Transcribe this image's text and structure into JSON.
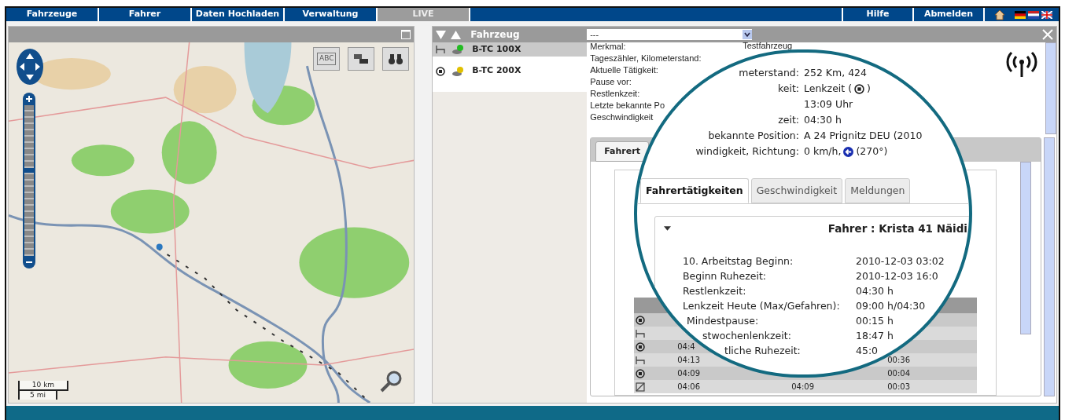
{
  "nav": {
    "tabs": [
      {
        "label": "Fahrzeuge",
        "selected": false
      },
      {
        "label": "Fahrer",
        "selected": false
      },
      {
        "label": "Daten Hochladen",
        "selected": false
      },
      {
        "label": "Verwaltung",
        "selected": false
      },
      {
        "label": "LIVE",
        "selected": true
      }
    ],
    "links": [
      "Hilfe",
      "Abmelden"
    ]
  },
  "map": {
    "toolbar": [
      {
        "kind": "labels",
        "text": "ABC"
      },
      {
        "kind": "traffic"
      },
      {
        "kind": "binoculars"
      }
    ],
    "zoom": {
      "level": 0.57
    },
    "scale": [
      "10 km",
      "5 mi"
    ]
  },
  "vehicles": {
    "header": "Fahrzeug",
    "filter": "---",
    "items": [
      {
        "name": "B-TC 100X",
        "kind": "rest",
        "selected": true,
        "color": "#22bb22"
      },
      {
        "name": "B-TC 200X",
        "kind": "driving",
        "selected": false,
        "color": "#e0c000"
      }
    ]
  },
  "details": {
    "labels": [
      "Merkmal:",
      "Tageszähler, Kilometerstand:",
      "Aktuelle Tätigkeit:",
      "Pause vor:",
      "Restlenkzeit:",
      "Letzte bekannte Po",
      "Geschwindigkeit"
    ],
    "value": "Testfahrzeug",
    "tab": "Fahrert"
  },
  "magnifier": {
    "rows": [
      {
        "kind": "plain",
        "label": "meterstand:",
        "value": "252 Km, 424"
      },
      {
        "kind": "driving",
        "label": "keit:",
        "value": "Lenkzeit (",
        "suffix": ")"
      },
      {
        "kind": "plain",
        "label": "",
        "value": "13:09 Uhr"
      },
      {
        "kind": "plain",
        "label": "zeit:",
        "value": "04:30 h"
      },
      {
        "kind": "plain",
        "label": "bekannte Position:",
        "value": "A 24 Prignitz DEU (2010"
      },
      {
        "kind": "direction",
        "label": "windigkeit, Richtung:",
        "value": "0 km/h,",
        "suffix": "(270°)"
      }
    ],
    "tabs": [
      {
        "label": "Fahrertätigkeiten",
        "selected": true
      },
      {
        "label": "Geschwindigkeit",
        "selected": false
      },
      {
        "label": "Meldungen",
        "selected": false
      }
    ],
    "card": {
      "title": "Fahrer : Krista 41 Näidi",
      "rows": [
        {
          "label": "10. Arbeitstag Beginn:",
          "value": "2010-12-03 03:02"
        },
        {
          "label": "Beginn Ruhezeit:",
          "value": "2010-12-03 16:0"
        },
        {
          "label": "Restlenkzeit:",
          "value": "04:30 h"
        },
        {
          "label": "Lenkzeit Heute (Max/Gefahren):",
          "value": "09:00 h/04:30"
        },
        {
          "label": "Mindestpause:",
          "value": "00:15 h"
        },
        {
          "label": "stwochenlenkzeit:",
          "value": "18:47 h"
        },
        {
          "label": "tliche Ruhezeit:",
          "value": "45:0"
        }
      ]
    }
  },
  "table": {
    "rows": [
      {
        "kind": "driving",
        "cells": [
          "",
          "",
          ""
        ]
      },
      {
        "kind": "rest",
        "cells": [
          "",
          "",
          ""
        ]
      },
      {
        "kind": "driving",
        "cells": [
          "04:4",
          "",
          ""
        ]
      },
      {
        "kind": "rest",
        "cells": [
          "04:13",
          "",
          "00:36"
        ]
      },
      {
        "kind": "driving",
        "cells": [
          "04:09",
          "",
          "00:04"
        ]
      },
      {
        "kind": "available",
        "cells": [
          "04:06",
          "04:09",
          "00:03"
        ]
      }
    ]
  }
}
